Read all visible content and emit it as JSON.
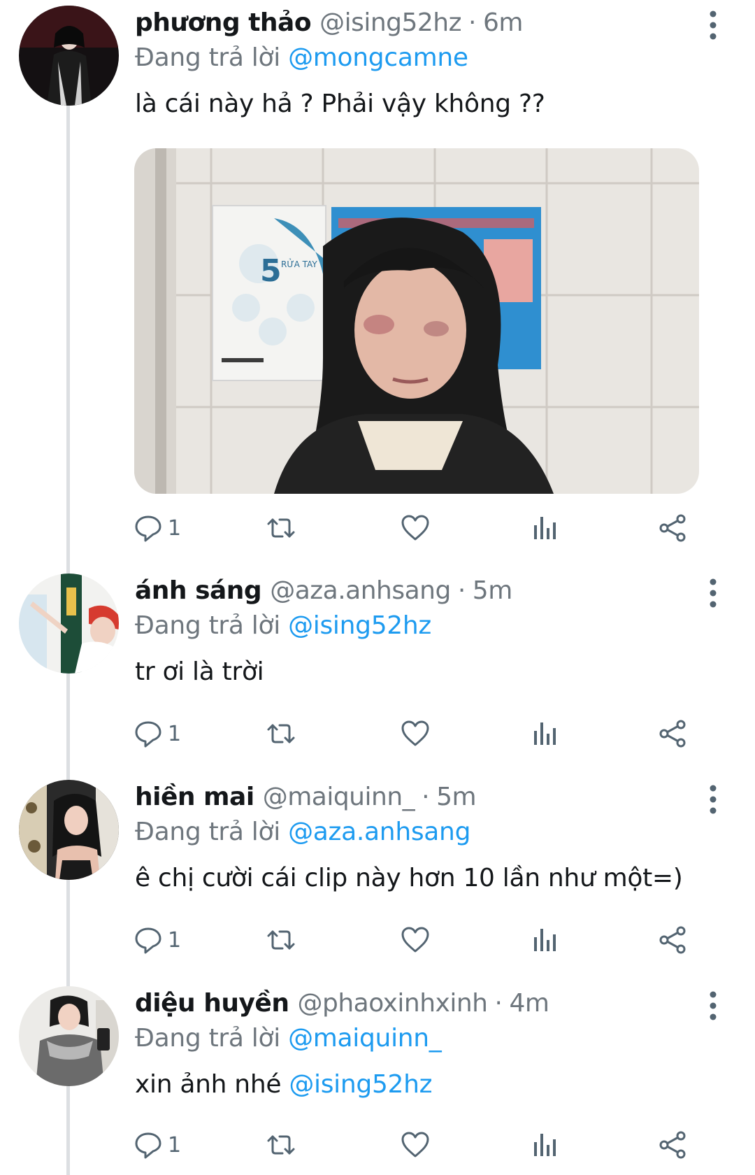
{
  "replying_prefix": "Đang trả lời",
  "tweets": [
    {
      "name": "phương thảo",
      "handle": "@ising52hz",
      "sep": "·",
      "time": "6m",
      "reply_to": "@mongcamne",
      "text": "là cái này hả ? Phải vậy không ??",
      "mention": "",
      "reply_count": "1",
      "media": {
        "poster_number": "5",
        "poster_text": "RỬA TAY"
      }
    },
    {
      "name": "ánh sáng",
      "handle": "@aza.anhsang",
      "sep": "·",
      "time": "5m",
      "reply_to": "@ising52hz",
      "text": "tr ơi là trời",
      "mention": "",
      "reply_count": "1"
    },
    {
      "name": "hiền mai",
      "handle": "@maiquinn_",
      "sep": "·",
      "time": "5m",
      "reply_to": "@aza.anhsang",
      "text": "ê chị cười cái clip này hơn 10 lần như một=)",
      "mention": "",
      "reply_count": "1"
    },
    {
      "name": "diệu huyền",
      "handle": "@phaoxinhxinh",
      "sep": "·",
      "time": "4m",
      "reply_to": "@maiquinn_",
      "text": "xin ảnh nhé ",
      "mention": "@ising52hz",
      "reply_count": "1"
    }
  ],
  "colors": {
    "link": "#1d9bf0",
    "secondary": "#6e767d",
    "icon": "#536471",
    "thread_line": "#dcdfe2"
  },
  "icons": [
    "reply-icon",
    "retweet-icon",
    "like-icon",
    "analytics-icon",
    "share-icon",
    "more-options-icon"
  ]
}
